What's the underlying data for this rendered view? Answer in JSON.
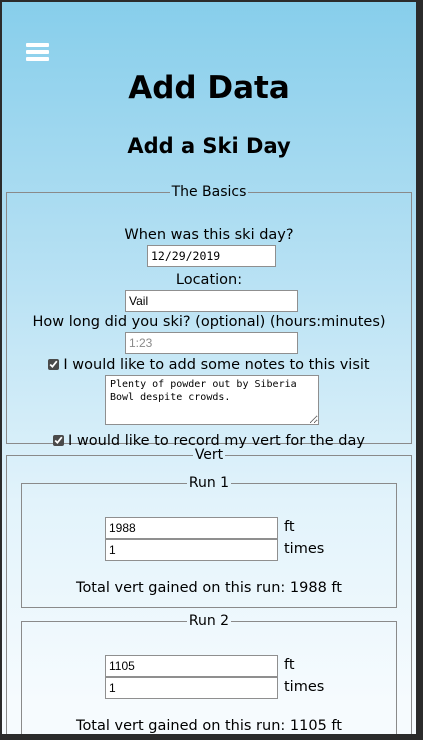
{
  "header": {
    "menu_icon": "hamburger-menu-icon",
    "title": "Add Data",
    "subtitle": "Add a Ski Day"
  },
  "basics": {
    "legend": "The Basics",
    "date_label": "When was this ski day?",
    "date_value": "12/29/2019",
    "location_label": "Location:",
    "location_value": "Vail",
    "duration_label": "How long did you ski? (optional) (hours:minutes)",
    "duration_placeholder": "1:23",
    "notes_checkbox_label": "I would like to add some notes to this visit",
    "notes_checked": true,
    "notes_value": "Plenty of powder out by Siberia Bowl despite crowds.",
    "vert_checkbox_label": "I would like to record my vert for the day",
    "vert_checked": true
  },
  "vert": {
    "legend": "Vert",
    "runs": [
      {
        "legend": "Run 1",
        "vert_value": "1988",
        "vert_unit": "ft",
        "times_value": "1",
        "times_unit": "times",
        "total_text": "Total vert gained on this run: 1988 ft"
      },
      {
        "legend": "Run 2",
        "vert_value": "1105",
        "vert_unit": "ft",
        "times_value": "1",
        "times_unit": "times",
        "total_text": "Total vert gained on this run: 1105 ft"
      }
    ]
  }
}
